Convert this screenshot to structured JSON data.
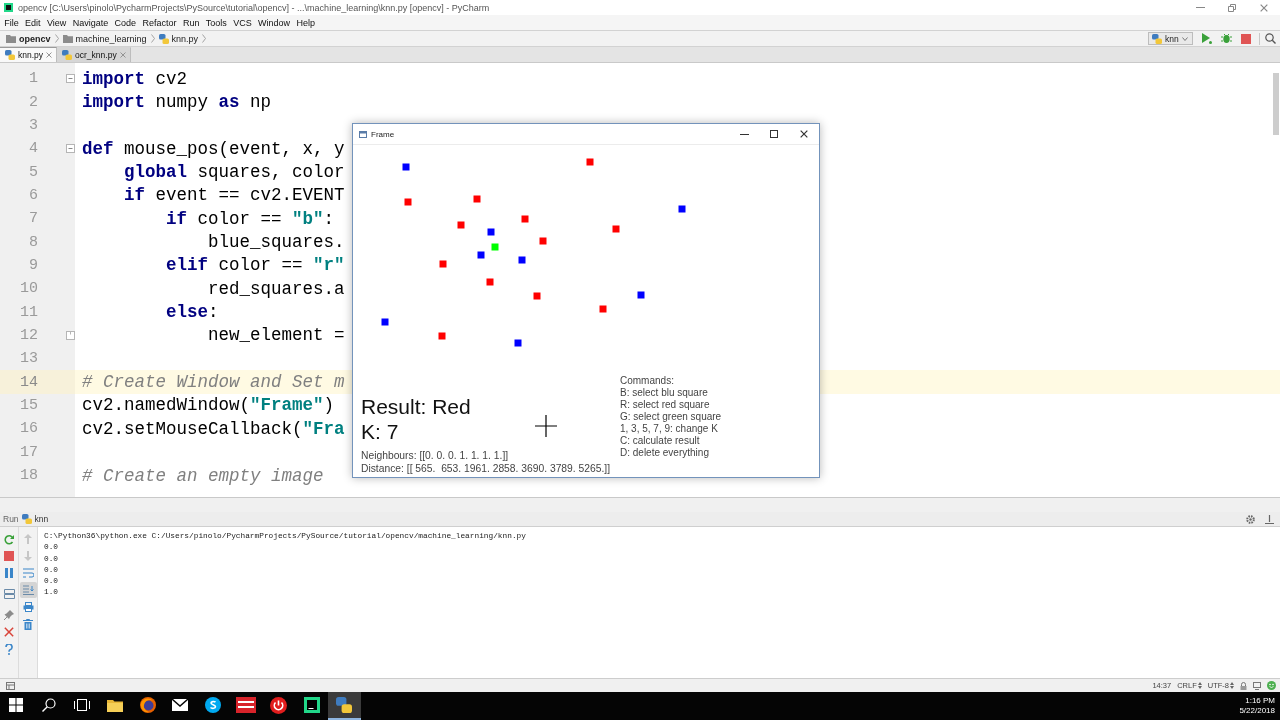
{
  "window": {
    "title": "opencv [C:\\Users\\pinolo\\PycharmProjects\\PySource\\tutorial\\opencv] - ...\\machine_learning\\knn.py [opencv] - PyCharm"
  },
  "menu": [
    "File",
    "Edit",
    "View",
    "Navigate",
    "Code",
    "Refactor",
    "Run",
    "Tools",
    "VCS",
    "Window",
    "Help"
  ],
  "breadcrumbs": [
    {
      "kind": "project",
      "label": "opencv"
    },
    {
      "kind": "folder",
      "label": "machine_learning"
    },
    {
      "kind": "file",
      "label": "knn.py"
    }
  ],
  "run_config": {
    "label": "knn"
  },
  "tabs": [
    {
      "label": "knn.py",
      "selected": true
    },
    {
      "label": "ocr_knn.py",
      "selected": false
    }
  ],
  "editor": {
    "lines": [
      {
        "number": "1",
        "current": false,
        "fold_start": true,
        "fold_end": false,
        "tokens": [
          {
            "kind": "keyword",
            "text": "import"
          },
          {
            "kind": "text",
            "text": " cv2"
          }
        ]
      },
      {
        "number": "2",
        "current": false,
        "fold_start": false,
        "fold_end": false,
        "tokens": [
          {
            "kind": "keyword",
            "text": "import"
          },
          {
            "kind": "text",
            "text": " numpy "
          },
          {
            "kind": "keyword",
            "text": "as"
          },
          {
            "kind": "text",
            "text": " np"
          }
        ]
      },
      {
        "number": "3",
        "current": false,
        "fold_start": false,
        "fold_end": false
      },
      {
        "number": "4",
        "current": false,
        "fold_start": true,
        "fold_end": false,
        "tokens": [
          {
            "kind": "keyword",
            "text": "def"
          },
          {
            "kind": "text",
            "text": " mouse_pos(event, x, y"
          }
        ]
      },
      {
        "number": "5",
        "current": false,
        "fold_start": false,
        "fold_end": false,
        "tokens": [
          {
            "kind": "keyword",
            "text": "    global"
          },
          {
            "kind": "text",
            "text": " squares, color"
          }
        ]
      },
      {
        "number": "6",
        "current": false,
        "fold_start": false,
        "fold_end": false,
        "tokens": [
          {
            "kind": "keyword",
            "text": "    if"
          },
          {
            "kind": "text",
            "text": " event == cv2.EVENT"
          }
        ]
      },
      {
        "number": "7",
        "current": false,
        "fold_start": false,
        "fold_end": false,
        "tokens": [
          {
            "kind": "keyword",
            "text": "        if"
          },
          {
            "kind": "text",
            "text": " color == "
          },
          {
            "kind": "string",
            "text": "\"b\""
          },
          {
            "kind": "text",
            "text": ":"
          }
        ]
      },
      {
        "number": "8",
        "current": false,
        "fold_start": false,
        "fold_end": false,
        "tokens": [
          {
            "kind": "text",
            "text": "            blue_squares."
          }
        ]
      },
      {
        "number": "9",
        "current": false,
        "fold_start": false,
        "fold_end": false,
        "tokens": [
          {
            "kind": "keyword",
            "text": "        elif"
          },
          {
            "kind": "text",
            "text": " color == "
          },
          {
            "kind": "string",
            "text": "\"r\""
          }
        ]
      },
      {
        "number": "10",
        "current": false,
        "fold_start": false,
        "fold_end": false,
        "tokens": [
          {
            "kind": "text",
            "text": "            red_squares.a"
          }
        ]
      },
      {
        "number": "11",
        "current": false,
        "fold_start": false,
        "fold_end": false,
        "tokens": [
          {
            "kind": "keyword",
            "text": "        else"
          },
          {
            "kind": "text",
            "text": ":"
          }
        ]
      },
      {
        "number": "12",
        "current": false,
        "fold_start": false,
        "fold_end": true,
        "tokens": [
          {
            "kind": "text",
            "text": "            new_element ="
          }
        ]
      },
      {
        "number": "13",
        "current": false,
        "fold_start": false,
        "fold_end": false
      },
      {
        "number": "14",
        "current": true,
        "fold_start": false,
        "fold_end": false,
        "tokens": [
          {
            "kind": "comment",
            "text": "# Create Window and Set m"
          }
        ]
      },
      {
        "number": "15",
        "current": false,
        "fold_start": false,
        "fold_end": false,
        "tokens": [
          {
            "kind": "text",
            "text": "cv2.namedWindow("
          },
          {
            "kind": "string",
            "text": "\"Frame\""
          },
          {
            "kind": "text",
            "text": ")"
          }
        ]
      },
      {
        "number": "16",
        "current": false,
        "fold_start": false,
        "fold_end": false,
        "tokens": [
          {
            "kind": "text",
            "text": "cv2.setMouseCallback("
          },
          {
            "kind": "string",
            "text": "\"Fra"
          }
        ]
      },
      {
        "number": "17",
        "current": false,
        "fold_start": false,
        "fold_end": false
      },
      {
        "number": "18",
        "current": false,
        "fold_start": false,
        "fold_end": false,
        "tokens": [
          {
            "kind": "comment",
            "text": "# Create an empty image"
          }
        ]
      }
    ]
  },
  "frame": {
    "title": "Frame",
    "squares": [
      {
        "color": "#ff0000"
      },
      {
        "color": "#0000ff"
      },
      {
        "color": "#ff0000"
      },
      {
        "color": "#ff0000"
      },
      {
        "color": "#0000ff"
      },
      {
        "color": "#ff0000"
      },
      {
        "color": "#ff0000"
      },
      {
        "color": "#ff0000"
      },
      {
        "color": "#0000ff"
      },
      {
        "color": "#ff0000"
      },
      {
        "color": "#00ff00"
      },
      {
        "color": "#0000ff"
      },
      {
        "color": "#0000ff"
      },
      {
        "color": "#ff0000"
      },
      {
        "color": "#ff0000"
      },
      {
        "color": "#0000ff"
      },
      {
        "color": "#ff0000"
      },
      {
        "color": "#ff0000"
      },
      {
        "color": "#0000ff"
      },
      {
        "color": "#ff0000"
      },
      {
        "color": "#0000ff"
      }
    ],
    "result": "Result: Red",
    "k": "K: 7",
    "neighbours": "Neighbours: [[0. 0. 0. 1. 1. 1. 1.]]",
    "distance": "Distance: [[ 565.  653. 1961. 2858. 3690. 3789. 5265.]]",
    "commands": [
      "Commands:",
      "B: select blu square",
      "R: select red square",
      "G: select green square",
      "1, 3, 5, 7, 9: change K",
      "C: calculate result",
      "D: delete everything"
    ]
  },
  "run_panel": {
    "title": "Run",
    "config": "knn",
    "previous_disabled": true,
    "next_disabled": true,
    "soft_wrap_on": false,
    "scroll_to_end_on": true,
    "output": [
      "C:\\Python36\\python.exe C:/Users/pinolo/PycharmProjects/PySource/tutorial/opencv/machine_learning/knn.py",
      "0.0",
      "0.0",
      "0.0",
      "0.0",
      "1.0"
    ]
  },
  "status_bar": {
    "position": "14:37",
    "line_separator": "CRLF",
    "encoding": "UTF-8"
  },
  "taskbar": {
    "apps": [
      {
        "kind": "explorer",
        "selected": false
      },
      {
        "kind": "firefox",
        "selected": false
      },
      {
        "kind": "mail",
        "selected": false
      },
      {
        "kind": "skype",
        "selected": false
      },
      {
        "kind": "video",
        "selected": false
      },
      {
        "kind": "power",
        "selected": false
      },
      {
        "kind": "pycharm",
        "selected": false
      },
      {
        "kind": "python",
        "selected": true
      }
    ],
    "time": "1:16 PM",
    "date": "5/22/2018"
  }
}
